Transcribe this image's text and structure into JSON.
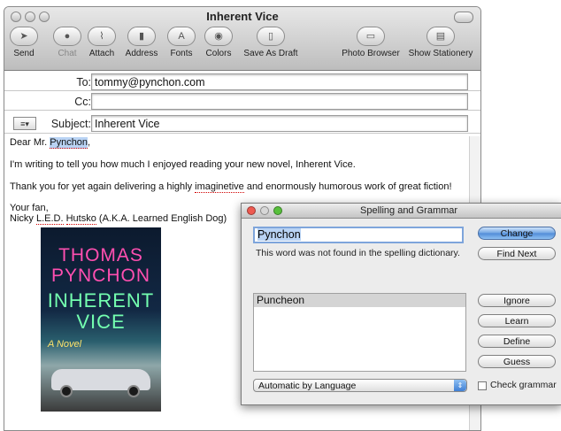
{
  "window": {
    "title": "Inherent Vice"
  },
  "toolbar": {
    "items": [
      {
        "label": "Send",
        "icon": "send-icon"
      },
      {
        "label": "Chat",
        "icon": "chat-icon"
      },
      {
        "label": "Attach",
        "icon": "paperclip-icon"
      },
      {
        "label": "Address",
        "icon": "address-book-icon"
      },
      {
        "label": "Fonts",
        "icon": "fonts-icon"
      },
      {
        "label": "Colors",
        "icon": "color-wheel-icon"
      },
      {
        "label": "Save As Draft",
        "icon": "draft-icon"
      },
      {
        "label": "Photo Browser",
        "icon": "photo-icon"
      },
      {
        "label": "Show Stationery",
        "icon": "stationery-icon"
      }
    ]
  },
  "headers": {
    "to_label": "To:",
    "to_value": "tommy@pynchon.com",
    "cc_label": "Cc:",
    "cc_value": "",
    "subject_label": "Subject:",
    "subject_value": "Inherent Vice"
  },
  "body": {
    "greeting_pre": "Dear Mr. ",
    "greeting_name": "Pynchon",
    "greeting_post": ",",
    "line1": "I'm writing to tell you how much I enjoyed reading your new novel, Inherent Vice.",
    "line2_pre": "Thank you for yet again delivering a highly ",
    "line2_mis": "imaginetive",
    "line2_post": " and enormously humorous work of great fiction!",
    "closing": "Your fan,",
    "sig_first": "Nicky ",
    "sig_mis1": "L.E.D.",
    "sig_space": " ",
    "sig_mis2": "Hutsko",
    "sig_post": " (A.K.A. Learned English Dog)"
  },
  "book_cover": {
    "line1": "THOMAS",
    "line2": "PYNCHON",
    "line3": "INHERENT",
    "line4": "VICE",
    "tag": "A Novel"
  },
  "spelling_panel": {
    "title": "Spelling and Grammar",
    "word": "Pynchon",
    "message": "This word was not found in the spelling dictionary.",
    "buttons": {
      "change": "Change",
      "find_next": "Find Next",
      "ignore": "Ignore",
      "learn": "Learn",
      "define": "Define",
      "guess": "Guess"
    },
    "suggestions": [
      "Puncheon"
    ],
    "language": "Automatic by Language",
    "check_grammar_label": "Check grammar",
    "check_grammar": false
  },
  "colors": {
    "default_button": "#4f8ad7",
    "selection": "#b9d3f4",
    "misspelling_underline": "#d00000"
  }
}
